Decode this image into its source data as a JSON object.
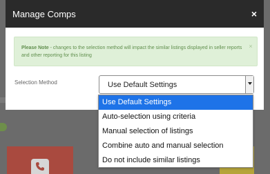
{
  "modal": {
    "title": "Manage Comps",
    "close_icon": "×"
  },
  "alert": {
    "note_label": "Please Note",
    "message": " - changes to the selection method will impact the similar listings displayed in seller reports and other reporting for this listing",
    "close_icon": "×"
  },
  "field": {
    "label": "Selection Method"
  },
  "select": {
    "value": "Use Default Settings",
    "options": [
      "Use Default Settings",
      "Auto-selection using criteria",
      "Manual selection of listings",
      "Combine auto and manual selection",
      "Do not include similar listings"
    ],
    "selected_index": 0
  },
  "colors": {
    "header_bg": "#2a2a2a",
    "alert_bg": "#dff0d8",
    "alert_text": "#5f8e4c",
    "option_highlight": "#1e73e8",
    "backdrop": "#6b6b6b"
  }
}
